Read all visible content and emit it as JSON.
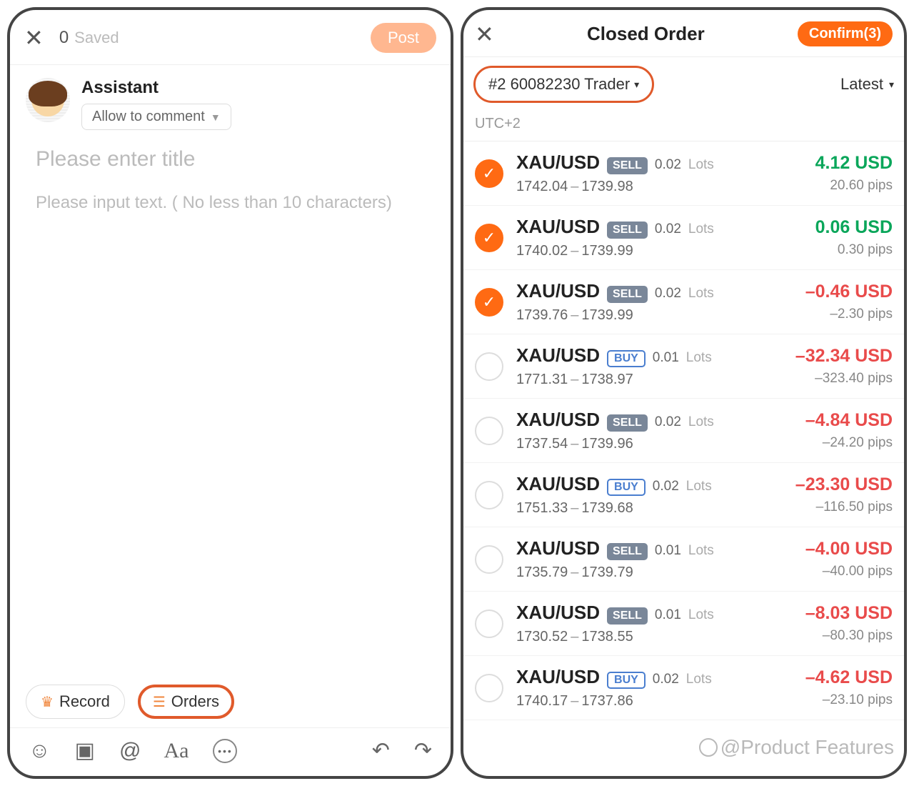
{
  "left": {
    "saved_count": "0",
    "saved_label": "Saved",
    "post_label": "Post",
    "assistant_name": "Assistant",
    "comment_toggle": "Allow to comment",
    "title_placeholder": "Please enter title",
    "body_placeholder": "Please input text. ( No less than 10 characters)",
    "record_chip": "Record",
    "orders_chip": "Orders"
  },
  "right": {
    "title": "Closed Order",
    "confirm_label": "Confirm(3)",
    "account_filter": "#2 60082230 Trader",
    "sort_label": "Latest",
    "timezone": "UTC+2",
    "watermark": "@Product Features",
    "orders": [
      {
        "checked": true,
        "symbol": "XAU/USD",
        "side": "SELL",
        "lots": "0.02",
        "open": "1742.04",
        "close": "1739.98",
        "pnl": "4.12 USD",
        "pnl_sign": "pos",
        "pips": "20.60 pips"
      },
      {
        "checked": true,
        "symbol": "XAU/USD",
        "side": "SELL",
        "lots": "0.02",
        "open": "1740.02",
        "close": "1739.99",
        "pnl": "0.06 USD",
        "pnl_sign": "pos",
        "pips": "0.30 pips"
      },
      {
        "checked": true,
        "symbol": "XAU/USD",
        "side": "SELL",
        "lots": "0.02",
        "open": "1739.76",
        "close": "1739.99",
        "pnl": "–0.46 USD",
        "pnl_sign": "neg",
        "pips": "–2.30 pips"
      },
      {
        "checked": false,
        "symbol": "XAU/USD",
        "side": "BUY",
        "lots": "0.01",
        "open": "1771.31",
        "close": "1738.97",
        "pnl": "–32.34 USD",
        "pnl_sign": "neg",
        "pips": "–323.40 pips"
      },
      {
        "checked": false,
        "symbol": "XAU/USD",
        "side": "SELL",
        "lots": "0.02",
        "open": "1737.54",
        "close": "1739.96",
        "pnl": "–4.84 USD",
        "pnl_sign": "neg",
        "pips": "–24.20 pips"
      },
      {
        "checked": false,
        "symbol": "XAU/USD",
        "side": "BUY",
        "lots": "0.02",
        "open": "1751.33",
        "close": "1739.68",
        "pnl": "–23.30 USD",
        "pnl_sign": "neg",
        "pips": "–116.50 pips"
      },
      {
        "checked": false,
        "symbol": "XAU/USD",
        "side": "SELL",
        "lots": "0.01",
        "open": "1735.79",
        "close": "1739.79",
        "pnl": "–4.00 USD",
        "pnl_sign": "neg",
        "pips": "–40.00 pips"
      },
      {
        "checked": false,
        "symbol": "XAU/USD",
        "side": "SELL",
        "lots": "0.01",
        "open": "1730.52",
        "close": "1738.55",
        "pnl": "–8.03 USD",
        "pnl_sign": "neg",
        "pips": "–80.30 pips"
      },
      {
        "checked": false,
        "symbol": "XAU/USD",
        "side": "BUY",
        "lots": "0.02",
        "open": "1740.17",
        "close": "1737.86",
        "pnl": "–4.62 USD",
        "pnl_sign": "neg",
        "pips": "–23.10 pips"
      }
    ],
    "lots_label": "Lots"
  }
}
